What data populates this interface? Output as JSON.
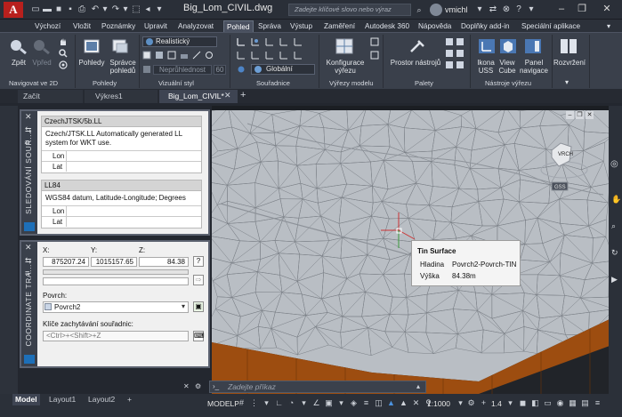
{
  "app": {
    "logo": "A",
    "title": "Big_Lom_CIVIL.dwg",
    "search_placeholder": "Zadejte klíčové slovo nebo výraz",
    "user": "vmichl"
  },
  "ribbon_tabs": [
    "Výchozí",
    "Vložit",
    "Poznámky",
    "Upravit",
    "Analyzovat",
    "Pohled",
    "Správa",
    "Výstup",
    "Zaměření",
    "Autodesk 360",
    "Nápověda",
    "Doplňky add-in",
    "Speciální aplikace"
  ],
  "active_tab": "Pohled",
  "ribbon": {
    "zpet": "Zpět",
    "vpred": "Vpřed",
    "pohledy": "Pohledy",
    "spravce": "Správce",
    "pohledu": "pohledů",
    "visual_style": "Realistický",
    "opacity": "Neprůhlednost",
    "opacity_value": "60",
    "ucs": "Globální",
    "konfigurace": "Konfigurace",
    "vyrezu": "výřezu",
    "prostor": "Prostor nástrojů",
    "ikona": "Ikona",
    "uss": "USS",
    "view": "View",
    "cube": "Cube",
    "panel": "Panel",
    "navigace": "navigace",
    "rozvrzeni": "Rozvržení",
    "panels": [
      "Navigovat ve 2D",
      "Pohledy",
      "Vizuální styl",
      "Souřadnice",
      "Výřezy modelu",
      "Palety",
      "Nástroje výřezu"
    ]
  },
  "file_tabs": [
    "Začít",
    "Výkres1",
    "Big_Lom_CIVIL*"
  ],
  "palette1": {
    "title": "SLEDOVÁNÍ SOUŘ...",
    "blocks": [
      {
        "header": "CzechJTSK/5b.LL",
        "desc": "Czech/JTSK.LL Automatically generated LL system for WKT use.",
        "rows": [
          "Lon",
          "Lat"
        ]
      },
      {
        "header": "LL84",
        "desc": "WGS84 datum, Latitude-Longitude; Degrees",
        "rows": [
          "Lon",
          "Lat"
        ]
      }
    ]
  },
  "palette2": {
    "title": "COORDINATE TRA...",
    "x_label": "X:",
    "y_label": "Y:",
    "z_label": "Z:",
    "x": "875207.24",
    "y": "1015157.65",
    "z": "84.38",
    "help": "?",
    "surface_label": "Povrch:",
    "surface": "Povrch2",
    "keys_label": "Klíče zachytávání souřadnic:",
    "keys": "<Ctrl>+<Shift>+Z"
  },
  "viewport": {
    "cube_top": "VRCH",
    "cube_wcs": "GSS"
  },
  "tooltip": {
    "title": "Tin Surface",
    "rows": [
      {
        "k": "Hladina",
        "v": "Povrch2-Povrch-TIN"
      },
      {
        "k": "Výška",
        "v": "84.38m"
      }
    ]
  },
  "command": {
    "placeholder": "Zadejte příkaz"
  },
  "layout_tabs": [
    "Model",
    "Layout1",
    "Layout2"
  ],
  "status": {
    "model": "MODELP",
    "scale": "1:1000",
    "zoom": "1.4"
  }
}
